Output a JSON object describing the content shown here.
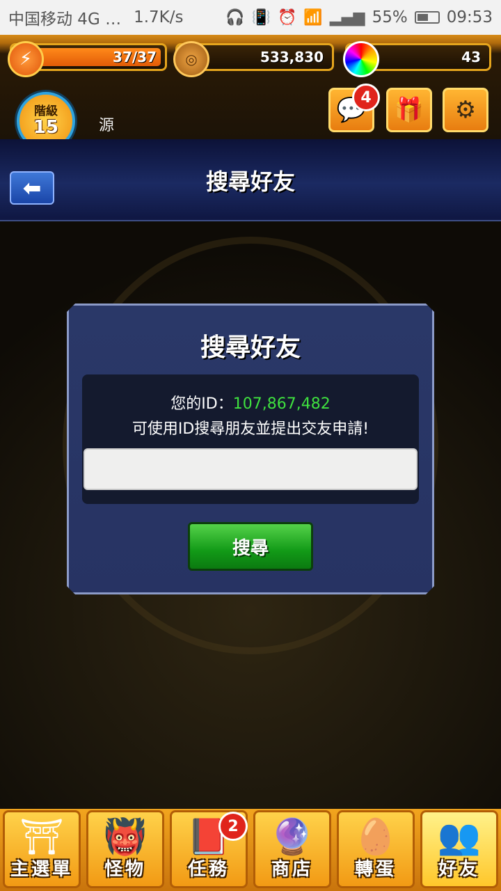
{
  "status_bar": {
    "carrier": "中国移动 4G …",
    "speed": "1.7K/s",
    "battery": "55%",
    "battery_level": 0.55,
    "time": "09:53"
  },
  "resources": {
    "energy": "37/37",
    "energy_level": 1.0,
    "coins": "533,830",
    "orbs": "43"
  },
  "player": {
    "rank_label": "階級",
    "rank": "15",
    "name": "源"
  },
  "header_buttons": {
    "message_badge": "4"
  },
  "page": {
    "title": "搜尋好友"
  },
  "dialog": {
    "title": "搜尋好友",
    "id_label": "您的ID：",
    "id_value": "107,867,482",
    "hint": "可使用ID搜尋朋友並提出交友申請!",
    "input_value": "",
    "search_label": "搜尋"
  },
  "bottom_nav": {
    "items": [
      {
        "label": "主選單",
        "icon": "gate-icon"
      },
      {
        "label": "怪物",
        "icon": "monster-icon"
      },
      {
        "label": "任務",
        "icon": "book-icon"
      },
      {
        "label": "商店",
        "icon": "orb-icon"
      },
      {
        "label": "轉蛋",
        "icon": "egg-icon"
      },
      {
        "label": "好友",
        "icon": "friends-icon"
      }
    ],
    "task_badge": "2",
    "active": "好友"
  },
  "colors": {
    "accent": "#f29a14",
    "dialog_bg": "#2a3868",
    "id_value": "#3fe03f",
    "search_button": "#129a17",
    "badge": "#e0241c"
  }
}
